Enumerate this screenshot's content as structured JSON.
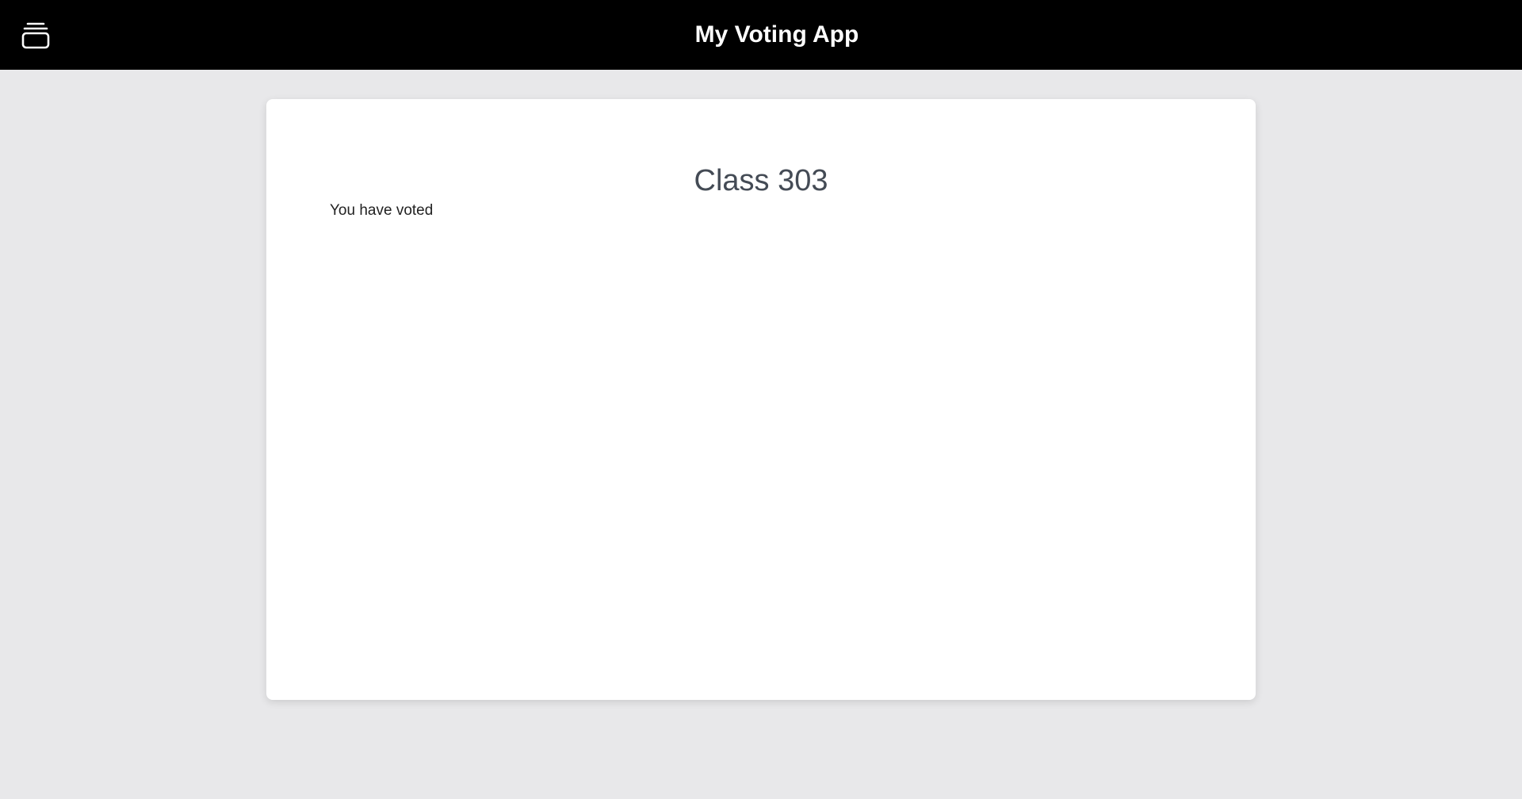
{
  "header": {
    "title": "My Voting App",
    "logo_icon": "stacked-cards-icon",
    "background": "#000000",
    "text_color": "#ffffff"
  },
  "main": {
    "class_title": "Class 303",
    "status_text": "You have voted",
    "background": "#e8e8ea",
    "card_background": "#ffffff"
  }
}
